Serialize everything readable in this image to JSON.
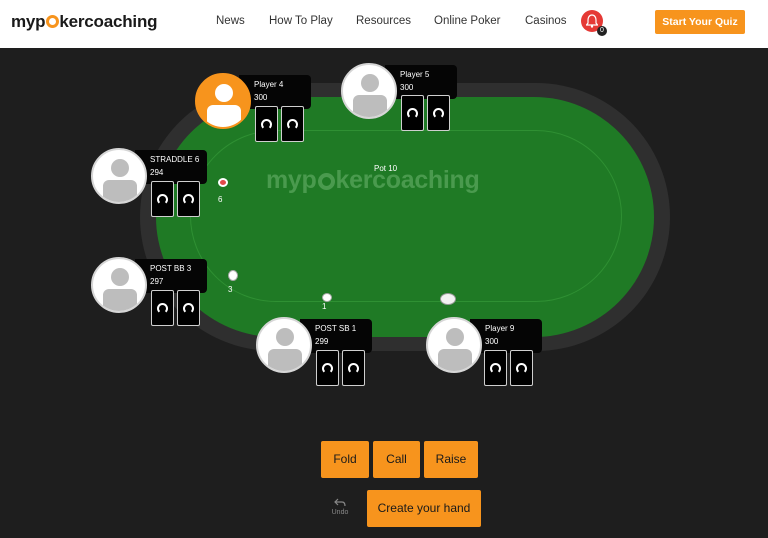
{
  "header": {
    "logo": {
      "pre": "myp",
      "post": "kercoaching"
    },
    "nav": [
      "News",
      "How To Play",
      "Resources",
      "Online Poker",
      "Casinos"
    ],
    "notification_count": "0",
    "cta": "Start Your Quiz"
  },
  "table": {
    "watermark": {
      "pre": "myp",
      "post": "kercoaching"
    },
    "pot": "Pot 10"
  },
  "seats": [
    {
      "name": "Player 4",
      "stack": "300",
      "active": true
    },
    {
      "name": "Player 5",
      "stack": "300",
      "active": false
    },
    {
      "name": "STRADDLE 6",
      "stack": "294",
      "active": false
    },
    {
      "name": "POST BB 3",
      "stack": "297",
      "active": false
    },
    {
      "name": "POST SB 1",
      "stack": "299",
      "active": false
    },
    {
      "name": "Player 9",
      "stack": "300",
      "active": false
    }
  ],
  "bets": [
    "6",
    "3",
    "1"
  ],
  "actions": {
    "fold": "Fold",
    "call": "Call",
    "raise": "Raise",
    "undo": "Undo",
    "create": "Create your hand"
  },
  "colors": {
    "accent": "#f7941d",
    "felt": "#1f7a25",
    "background": "#1e1e1e",
    "bell": "#e53935"
  }
}
